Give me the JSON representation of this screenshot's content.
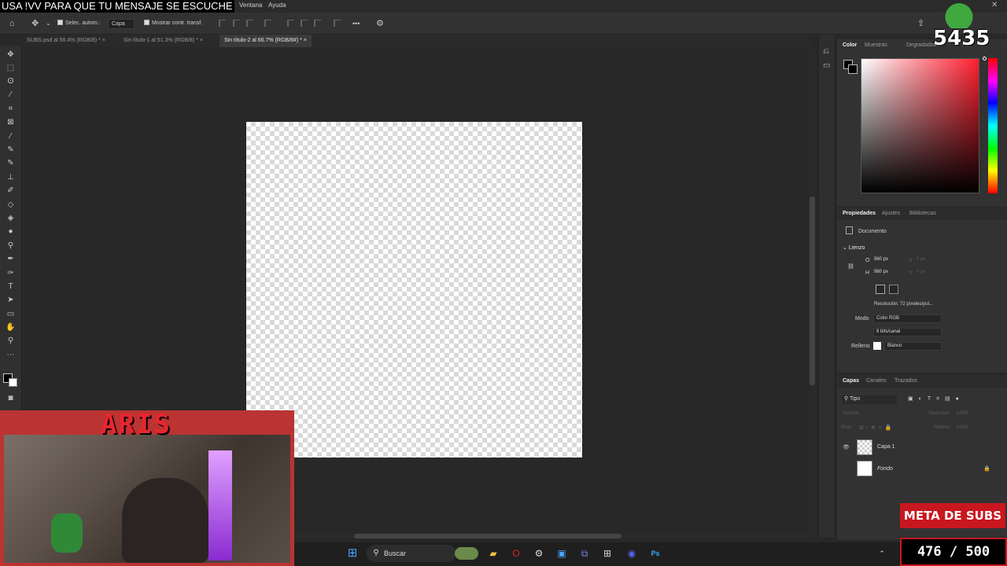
{
  "menubar": {
    "ticker": "USA !VV PARA QUE TU MENSAJE SE ESCUCHE",
    "items": [
      "Ventana",
      "Ayuda"
    ]
  },
  "options": {
    "auto_select_label": "Selec. autom.:",
    "auto_select_value": "Capa",
    "show_transform_label": "Mostrar contr. transf.",
    "more": "•••"
  },
  "tabs": [
    "SUBS.psd al 56.4% (RGB/8) *",
    "Sin título-1 al 51.3% (RGB/8) *",
    "Sin título-2 al 66.7% (RGB/8#) *"
  ],
  "tab_close": "×",
  "color_panel": {
    "tabs": [
      "Color",
      "Muestras",
      "Degradados"
    ],
    "accent": "#ff1f2f"
  },
  "properties": {
    "tabs": [
      "Propiedades",
      "Ajustes",
      "Bibliotecas"
    ],
    "doc_label": "Documento",
    "section": "Lienzo",
    "w_label": "O",
    "w_value": "960 px",
    "h_label": "H",
    "h_value": "960 px",
    "x_label": "X",
    "x_value": "0 px",
    "y_label": "Y",
    "y_value": "0 px",
    "resolution": "Resolución: 72 píxeles/pul...",
    "mode_label": "Modo",
    "mode_value": "Color RGB",
    "depth_value": "8 bits/canal",
    "fill_label": "Relleno",
    "fill_value": "Blanco"
  },
  "layers": {
    "tabs": [
      "Capas",
      "Canales",
      "Trazados"
    ],
    "filter": "Tipo",
    "blend": "Normal",
    "opacity_label": "Opacidad:",
    "opacity_value": "100%",
    "lock_label": "Bloq.:",
    "fill_label": "Relleno:",
    "fill_value": "100%",
    "items": [
      {
        "name": "Capa 1",
        "visible": true
      },
      {
        "name": "Fondo",
        "visible": false
      }
    ]
  },
  "overlay": {
    "streamer": "ARIS",
    "viewers": "5435",
    "sub_goal_label": "META DE SUBS",
    "sub_goal_count": "476 / 500"
  },
  "taskbar": {
    "search_label": "Buscar"
  }
}
